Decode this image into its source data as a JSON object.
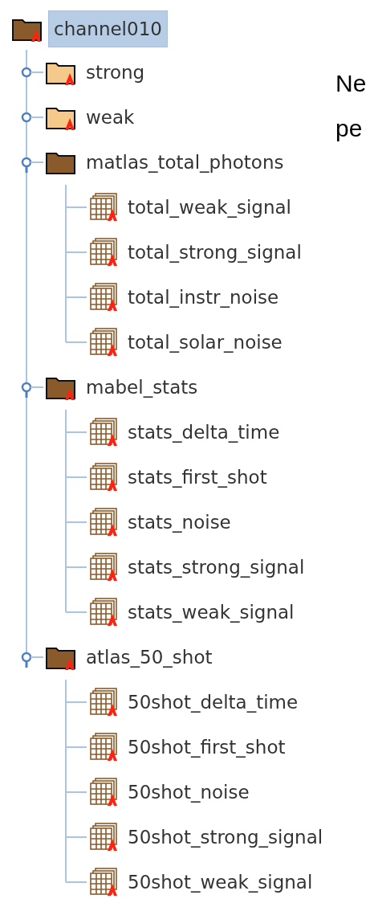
{
  "tree": {
    "label": "channel010",
    "kind": "group",
    "expanded": true,
    "selected": true,
    "has_attributes": true,
    "children": [
      {
        "label": "strong",
        "kind": "group",
        "expanded": false,
        "selected": false,
        "has_attributes": true
      },
      {
        "label": "weak",
        "kind": "group",
        "expanded": false,
        "selected": false,
        "has_attributes": true
      },
      {
        "label": "matlas_total_photons",
        "kind": "group",
        "expanded": true,
        "selected": false,
        "has_attributes": false,
        "children": [
          {
            "label": "total_weak_signal",
            "kind": "dataset",
            "selected": false,
            "has_attributes": true
          },
          {
            "label": "total_strong_signal",
            "kind": "dataset",
            "selected": false,
            "has_attributes": true
          },
          {
            "label": "total_instr_noise",
            "kind": "dataset",
            "selected": false,
            "has_attributes": true
          },
          {
            "label": "total_solar_noise",
            "kind": "dataset",
            "selected": false,
            "has_attributes": true
          }
        ]
      },
      {
        "label": "mabel_stats",
        "kind": "group",
        "expanded": true,
        "selected": false,
        "has_attributes": true,
        "children": [
          {
            "label": "stats_delta_time",
            "kind": "dataset",
            "selected": false,
            "has_attributes": true
          },
          {
            "label": "stats_first_shot",
            "kind": "dataset",
            "selected": false,
            "has_attributes": true
          },
          {
            "label": "stats_noise",
            "kind": "dataset",
            "selected": false,
            "has_attributes": true
          },
          {
            "label": "stats_strong_signal",
            "kind": "dataset",
            "selected": false,
            "has_attributes": true
          },
          {
            "label": "stats_weak_signal",
            "kind": "dataset",
            "selected": false,
            "has_attributes": true
          }
        ]
      },
      {
        "label": "atlas_50_shot",
        "kind": "group",
        "expanded": true,
        "selected": false,
        "has_attributes": true,
        "children": [
          {
            "label": "50shot_delta_time",
            "kind": "dataset",
            "selected": false,
            "has_attributes": true
          },
          {
            "label": "50shot_first_shot",
            "kind": "dataset",
            "selected": false,
            "has_attributes": true
          },
          {
            "label": "50shot_noise",
            "kind": "dataset",
            "selected": false,
            "has_attributes": true
          },
          {
            "label": "50shot_strong_signal",
            "kind": "dataset",
            "selected": false,
            "has_attributes": true
          },
          {
            "label": "50shot_weak_signal",
            "kind": "dataset",
            "selected": false,
            "has_attributes": true
          }
        ]
      }
    ]
  },
  "side_text": [
    "Ne",
    "pe"
  ]
}
